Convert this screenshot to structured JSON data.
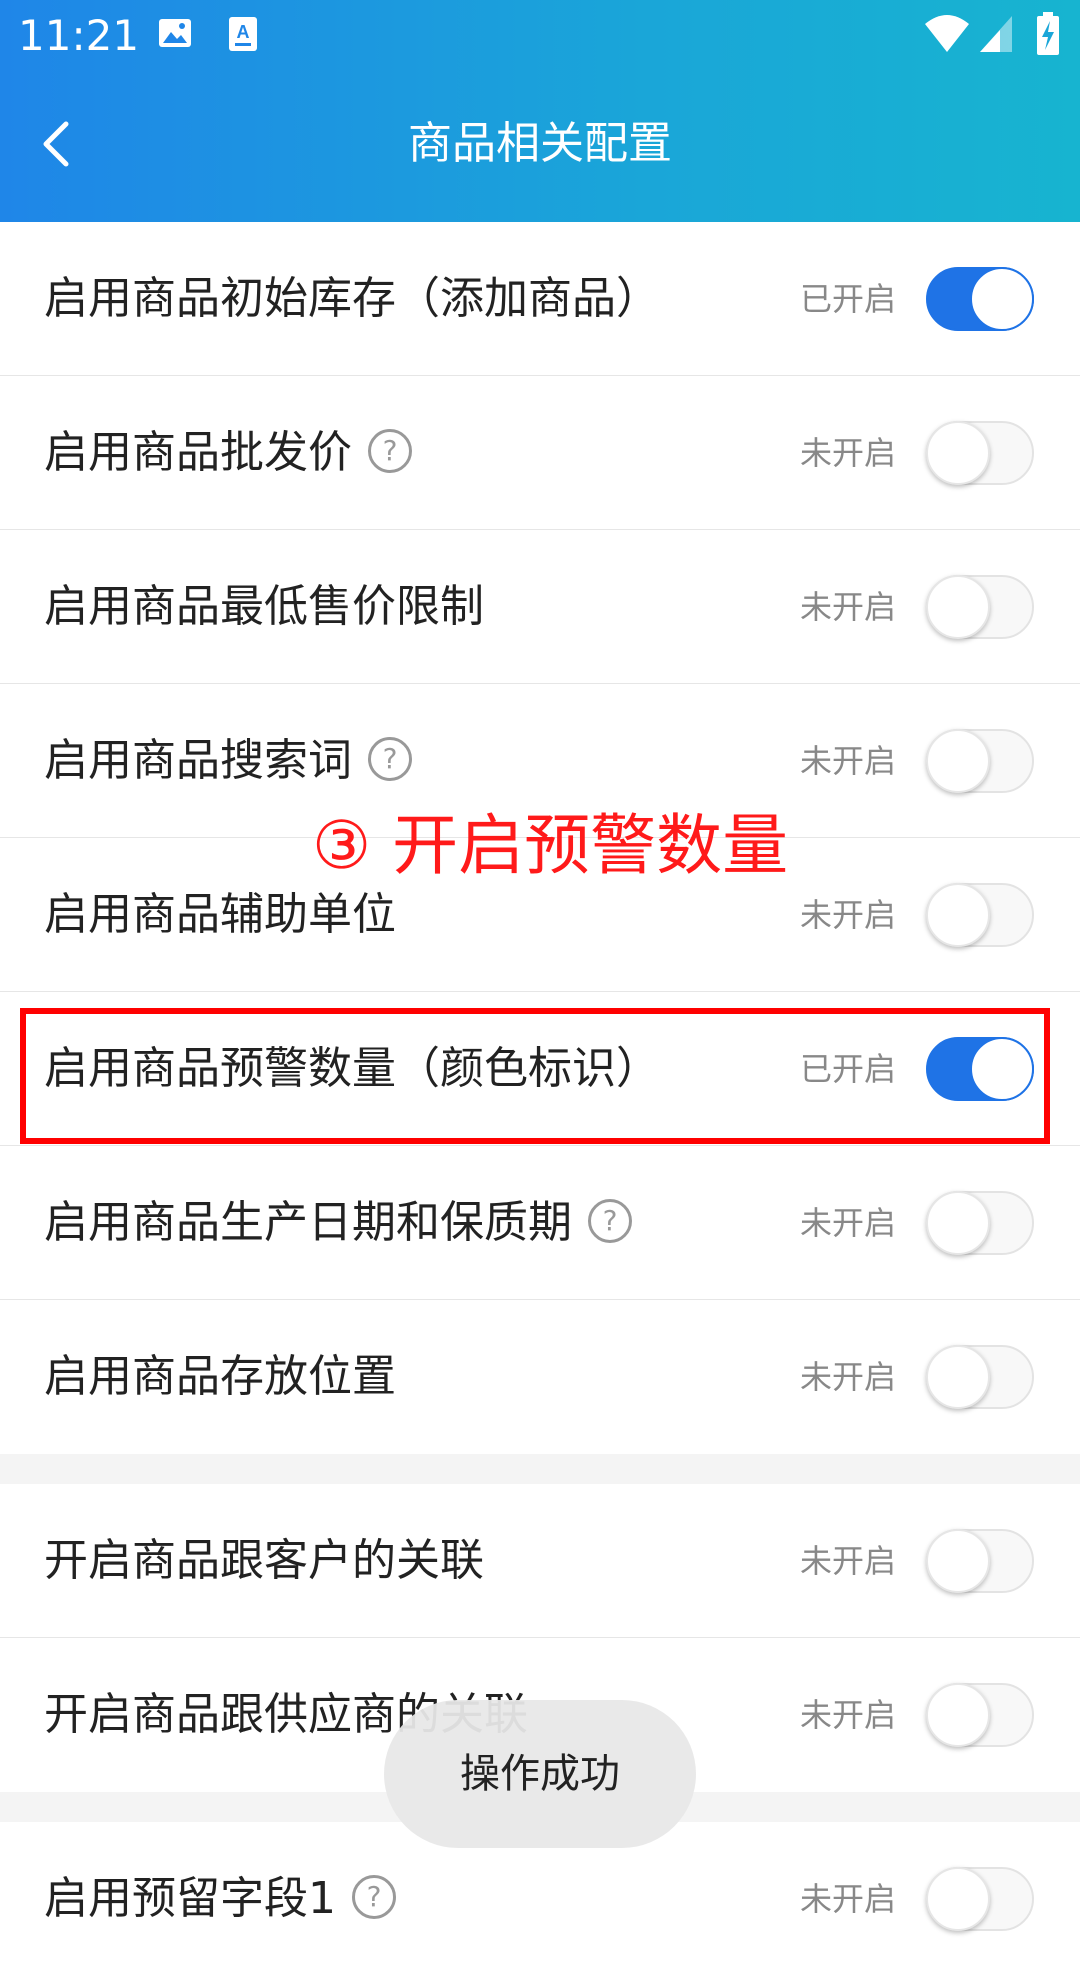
{
  "status_bar": {
    "time": "11:21",
    "icons": [
      "image-icon",
      "font-icon",
      "wifi-icon",
      "signal-icon",
      "battery-charging-icon"
    ]
  },
  "header": {
    "title": "商品相关配置",
    "back_icon": "chevron-left-icon",
    "gradient": [
      "#1f86e8",
      "#17b4d0"
    ]
  },
  "groups": [
    {
      "rows": [
        {
          "label": "启用商品初始库存（添加商品）",
          "help": false,
          "status": "已开启",
          "enabled": true
        },
        {
          "label": "启用商品批发价",
          "help": true,
          "status": "未开启",
          "enabled": false
        },
        {
          "label": "启用商品最低售价限制",
          "help": false,
          "status": "未开启",
          "enabled": false
        },
        {
          "label": "启用商品搜索词",
          "help": true,
          "status": "未开启",
          "enabled": false
        },
        {
          "label": "启用商品辅助单位",
          "help": false,
          "status": "未开启",
          "enabled": false
        },
        {
          "label": "启用商品预警数量（颜色标识）",
          "help": false,
          "status": "已开启",
          "enabled": true
        },
        {
          "label": "启用商品生产日期和保质期",
          "help": true,
          "status": "未开启",
          "enabled": false
        },
        {
          "label": "启用商品存放位置",
          "help": false,
          "status": "未开启",
          "enabled": false
        }
      ]
    },
    {
      "rows": [
        {
          "label": "开启商品跟客户的关联",
          "help": false,
          "status": "未开启",
          "enabled": false
        },
        {
          "label": "开启商品跟供应商的关联",
          "help": false,
          "status": "未开启",
          "enabled": false
        }
      ]
    },
    {
      "rows": [
        {
          "label": "启用预留字段1",
          "help": true,
          "status": "未开启",
          "enabled": false
        }
      ]
    }
  ],
  "help_glyph": "?",
  "annotation": {
    "text": "③ 开启预警数量",
    "color": "#ff1a1a"
  },
  "toast": {
    "text": "操作成功"
  },
  "colors": {
    "toggle_on": "#1f73e6",
    "toggle_off": "#f8f8f8",
    "highlight_border": "#ff0000"
  }
}
